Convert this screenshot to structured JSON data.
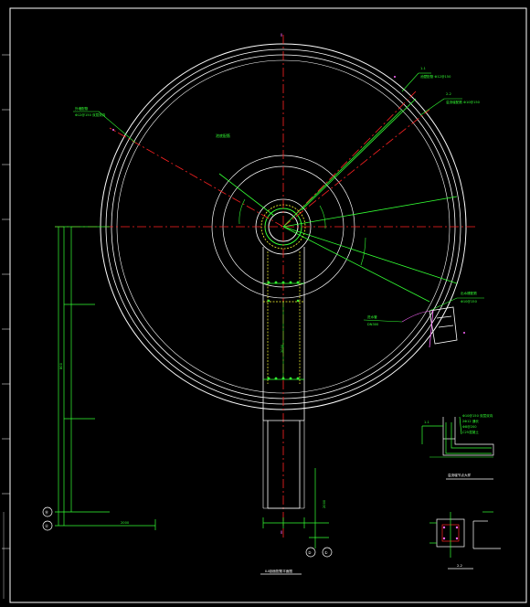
{
  "drawing": {
    "title": "Ⅱ-Ⅱ剖面配筋平面图",
    "center_label": "池底配筋",
    "axis_top": "Ⅱ",
    "axis_bottom": "Ⅱ",
    "left_axis_labels": [
      "Ⓑ",
      "Ⓐ"
    ],
    "bottom_axis_labels": [
      "②",
      "①"
    ],
    "section_1_title": "1-1",
    "section_2_title": "2-2",
    "detail_caption": "溢流堰节点大样",
    "detail_title_small": "2-2",
    "dim_total": "800",
    "dim_bottom": "2000",
    "dim_side": "2000"
  },
  "callouts": [
    {
      "title": "外墙配筋",
      "text": "Φ12@150 双层双向"
    },
    {
      "title": "1-1",
      "text": "池壁配筋 Φ12@150"
    },
    {
      "title": "2-2",
      "text": "溢流堰配筋 Φ10@150"
    },
    {
      "title": "出水槽配筋",
      "text": "Φ10@150"
    },
    {
      "title": "进水管",
      "text": "DN300"
    }
  ],
  "detail_notes": [
    "Φ10@150 双层双向",
    "2Φ12 通长",
    "Φ8@200",
    "C25混凝土"
  ],
  "colors": {
    "background": "#000000",
    "outline": "#ffffff",
    "center_line": "#ff2222",
    "rebar": "#33ff33",
    "dim": "#00ff66",
    "hidden": "#ffff33",
    "accent": "#ff66ff",
    "cyan": "#33ccff"
  }
}
